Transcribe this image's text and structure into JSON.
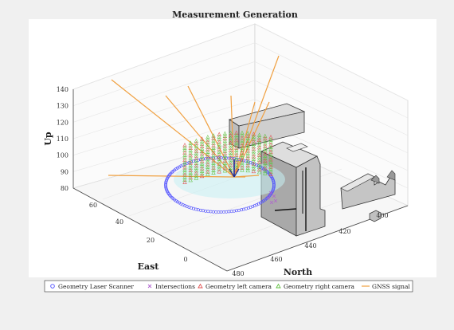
{
  "chart_data": {
    "type": "scatter",
    "title": "Measurement Generation",
    "xlabel": "North",
    "ylabel": "East",
    "zlabel": "Up",
    "x_ticks": [
      "400",
      "420",
      "440",
      "460",
      "480"
    ],
    "y_ticks": [
      "0",
      "20",
      "40",
      "60"
    ],
    "z_ticks": [
      "80",
      "90",
      "100",
      "110",
      "120",
      "130",
      "140"
    ],
    "xlim": [
      390,
      490
    ],
    "ylim": [
      -10,
      75
    ],
    "zlim": [
      80,
      145
    ],
    "grid": true,
    "legend_position": "bottom",
    "series": [
      {
        "name": "Geometry Laser Scanner",
        "marker": "circle",
        "color": "#4c4cff"
      },
      {
        "name": "Intersections",
        "marker": "x",
        "color": "#b060d0"
      },
      {
        "name": "Geometry left camera",
        "marker": "triangle",
        "color": "#e05050"
      },
      {
        "name": "Geometry right camera",
        "marker": "triangle",
        "color": "#60c040"
      },
      {
        "name": "GNSS signal",
        "marker": "line",
        "color": "#f0a040"
      }
    ]
  }
}
